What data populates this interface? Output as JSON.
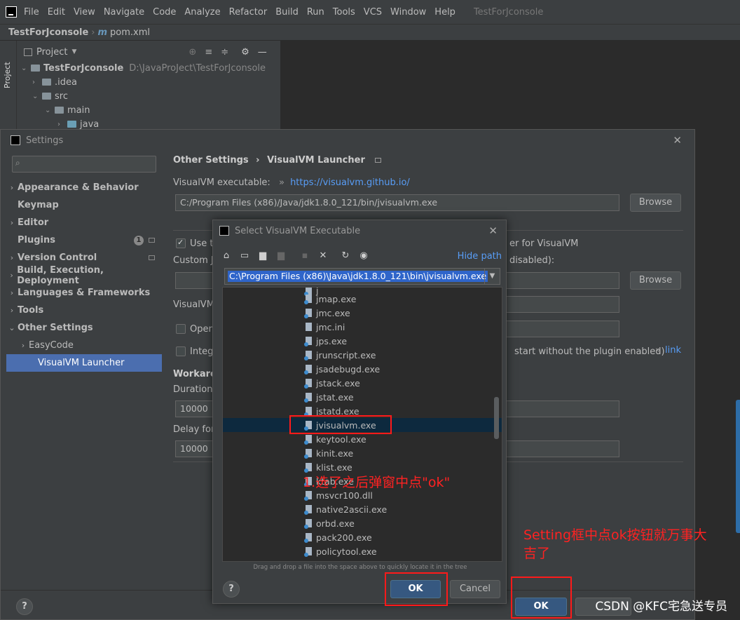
{
  "menubar": {
    "items": [
      "File",
      "Edit",
      "View",
      "Navigate",
      "Code",
      "Analyze",
      "Refactor",
      "Build",
      "Run",
      "Tools",
      "VCS",
      "Window",
      "Help"
    ],
    "title": "TestForJconsole"
  },
  "breadcrumb": {
    "project": "TestForJconsole",
    "file": "pom.xml",
    "file_icon": "m"
  },
  "toolstrip": {
    "project_label": "Project"
  },
  "project_panel": {
    "title": "Project",
    "root": {
      "name": "TestForJconsole",
      "path": "D:\\JavaProJect\\TestForJconsole"
    },
    "items": [
      ".idea",
      "src",
      "main",
      "java"
    ]
  },
  "settings": {
    "title": "Settings",
    "nav": [
      {
        "label": "Appearance & Behavior",
        "chevron": "›"
      },
      {
        "label": "Keymap",
        "chevron": ""
      },
      {
        "label": "Editor",
        "chevron": "›"
      },
      {
        "label": "Plugins",
        "chevron": "",
        "badge": "1"
      },
      {
        "label": "Version Control",
        "chevron": "›"
      },
      {
        "label": "Build, Execution, Deployment",
        "chevron": "›"
      },
      {
        "label": "Languages & Frameworks",
        "chevron": "›"
      },
      {
        "label": "Tools",
        "chevron": "›"
      },
      {
        "label": "Other Settings",
        "chevron": "⌄"
      },
      {
        "label": "EasyCode",
        "chevron": "›"
      },
      {
        "label": "VisualVM Launcher",
        "chevron": ""
      }
    ],
    "breadcrumb_parent": "Other Settings",
    "breadcrumb_sep": "›",
    "breadcrumb_page": "VisualVM Launcher",
    "executable_label": "VisualVM executable:",
    "executable_link_prefix": "»",
    "executable_link": "https://visualvm.github.io/",
    "executable_value": "C:/Program Files (x86)/Java/jdk1.8.0_121/bin/jvisualvm.exe",
    "browse_label": "Browse",
    "use_label": "Use th",
    "use_tail": "er for VisualVM",
    "custom_jdk_label": "Custom JD",
    "custom_jdk_tail": "disabled):",
    "visualvm_label": "VisualVM",
    "open_label": "Open",
    "integ_label": "Integr",
    "integ_tail": "start without the plugin enabled)",
    "integ_link_prefix": "»",
    "integ_link": "link",
    "workaround_label": "Workarou",
    "duration_label": "Duration f",
    "duration_value": "10000",
    "delay_label": "Delay for",
    "delay_value": "10000",
    "ok_label": "OK",
    "help_label": "?"
  },
  "chooser": {
    "title": "Select VisualVM Executable",
    "hide_path": "Hide path",
    "path_value": "C:\\Program Files (x86)\\Java\\jdk1.8.0_121\\bin\\jvisualvm.exe",
    "files": [
      {
        "name": "jmap.exe",
        "type": "exe"
      },
      {
        "name": "jmc.exe",
        "type": "exe"
      },
      {
        "name": "jmc.ini",
        "type": "ini"
      },
      {
        "name": "jps.exe",
        "type": "exe"
      },
      {
        "name": "jrunscript.exe",
        "type": "exe"
      },
      {
        "name": "jsadebugd.exe",
        "type": "exe"
      },
      {
        "name": "jstack.exe",
        "type": "exe"
      },
      {
        "name": "jstat.exe",
        "type": "exe"
      },
      {
        "name": "jstatd.exe",
        "type": "exe"
      },
      {
        "name": "jvisualvm.exe",
        "type": "exe",
        "selected": true
      },
      {
        "name": "keytool.exe",
        "type": "exe"
      },
      {
        "name": "kinit.exe",
        "type": "exe"
      },
      {
        "name": "klist.exe",
        "type": "exe"
      },
      {
        "name": "ktab.exe",
        "type": "exe"
      },
      {
        "name": "msvcr100.dll",
        "type": "dll"
      },
      {
        "name": "native2ascii.exe",
        "type": "exe"
      },
      {
        "name": "orbd.exe",
        "type": "exe"
      },
      {
        "name": "pack200.exe",
        "type": "exe"
      },
      {
        "name": "policytool.exe",
        "type": "exe"
      }
    ],
    "drop_hint": "Drag and drop a file into the space above to quickly locate it in the tree",
    "ok_label": "OK",
    "cancel_label": "Cancel",
    "help_label": "?"
  },
  "annotations": {
    "note1": "1.选了之后弹窗中点\"ok\"",
    "note2_line1": "Setting框中点ok按钮就万事大",
    "note2_line2": "吉了",
    "color": "#ff1a1a"
  },
  "watermark": "CSDN @KFC宅急送专员"
}
